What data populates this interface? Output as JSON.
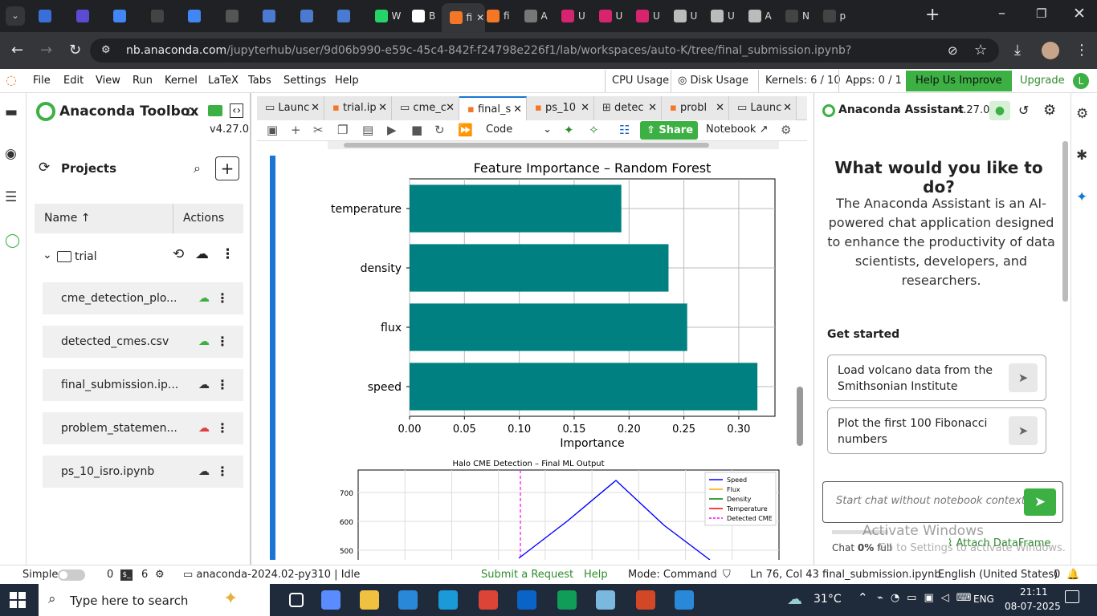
{
  "browser": {
    "tabs": [
      {
        "label": "",
        "color": "#3a6fd8"
      },
      {
        "label": "",
        "color": "#5b4bd1"
      },
      {
        "label": "",
        "color": "#4285f4"
      },
      {
        "label": "",
        "color": "#444"
      },
      {
        "label": "",
        "color": "#4285f4"
      },
      {
        "label": "",
        "color": "#555"
      },
      {
        "label": "",
        "color": "#4a7bd0"
      },
      {
        "label": "",
        "color": "#4a7bd0"
      },
      {
        "label": "",
        "color": "#4a7bd0"
      },
      {
        "label": "W",
        "color": "#25d366"
      },
      {
        "label": "B",
        "color": "#fff"
      },
      {
        "label": "fi",
        "color": "#f37726"
      },
      {
        "label": "fi",
        "color": "#f37726"
      },
      {
        "label": "A",
        "color": "#777"
      },
      {
        "label": "U",
        "color": "#d6246e"
      },
      {
        "label": "U",
        "color": "#d6246e"
      },
      {
        "label": "U",
        "color": "#d6246e"
      },
      {
        "label": "U",
        "color": "#bbb"
      },
      {
        "label": "U",
        "color": "#bbb"
      },
      {
        "label": "A",
        "color": "#bbb"
      },
      {
        "label": "N",
        "color": "#444"
      },
      {
        "label": "p",
        "color": "#444"
      }
    ],
    "url_host": "nb.anaconda.com",
    "url_path": "/jupyterhub/user/9d06b990-e59c-45c4-842f-f24798e226f1/lab/workspaces/auto-K/tree/final_submission.ipynb?"
  },
  "menu": {
    "items": [
      "File",
      "Edit",
      "View",
      "Run",
      "Kernel",
      "LaTeX",
      "Tabs",
      "Settings",
      "Help"
    ],
    "cpu": "CPU Usage",
    "disk": "Disk Usage",
    "kernels": "Kernels: 6 / 10",
    "apps": "Apps: 0 / 1",
    "help_improve": "Help Us Improve",
    "upgrade": "Upgrade",
    "avatar_letter": "L"
  },
  "toolbox": {
    "title": "Anaconda Toolbox",
    "version": "v4.27.0",
    "projects_label": "Projects",
    "col_name": "Name",
    "col_actions": "Actions",
    "folder": "trial",
    "files": [
      {
        "name": "cme_detection_plo...",
        "status": "synced"
      },
      {
        "name": "detected_cmes.csv",
        "status": "synced"
      },
      {
        "name": "final_submission.ip...",
        "status": "pending"
      },
      {
        "name": "problem_statemen...",
        "status": "error"
      },
      {
        "name": "ps_10_isro.ipynb",
        "status": "pending"
      }
    ]
  },
  "notebook": {
    "tabs": [
      "Launc",
      "trial.ip",
      "cme_c",
      "final_s",
      "ps_10",
      "detec",
      "probl",
      "Launc"
    ],
    "celltype": "Code",
    "share": "Share",
    "notebook_label": "Notebook"
  },
  "chart_data": [
    {
      "type": "bar",
      "orientation": "horizontal",
      "title": "Feature Importance – Random Forest",
      "xlabel": "Importance",
      "ylabel": "",
      "categories": [
        "temperature",
        "density",
        "flux",
        "speed"
      ],
      "values": [
        0.193,
        0.236,
        0.253,
        0.317
      ],
      "xlim": [
        0,
        0.333
      ],
      "xticks": [
        "0.00",
        "0.05",
        "0.10",
        "0.15",
        "0.20",
        "0.25",
        "0.30"
      ],
      "color": "#008080",
      "grid": true
    },
    {
      "type": "line",
      "title": "Halo CME Detection – Final ML Output",
      "yticks": [
        "700",
        "600",
        "500"
      ],
      "legend": [
        "Speed",
        "Flux",
        "Density",
        "Temperature",
        "Detected CME"
      ],
      "legend_colors": [
        "#0000ff",
        "#ffa500",
        "#008000",
        "#ff0000",
        "#ff00ff"
      ],
      "legend_position": "top-right",
      "grid": true
    }
  ],
  "assistant": {
    "title": "Anaconda Assistant",
    "version": "4.27.0",
    "heading": "What would you like to do?",
    "description": "The Anaconda Assistant is an AI-powered chat application designed to enhance the productivity of data scientists, developers, and researchers.",
    "get_started": "Get started",
    "suggestions": [
      "Load volcano data from the Smithsonian Institute",
      "Plot the first 100 Fibonacci numbers"
    ],
    "input_placeholder": "Start chat without notebook context...",
    "chat_label": "Chat",
    "chat_pct": "0%",
    "chat_full": "full",
    "attach": "Attach DataFrame",
    "watermark1": "Activate Windows",
    "watermark2": "Go to Settings to activate Windows."
  },
  "status": {
    "mode_label": "Simple",
    "count1": "0",
    "count2": "6",
    "env": "anaconda-2024.02-py310 | Idle",
    "submit": "Submit a Request",
    "help": "Help",
    "mode": "Mode: Command",
    "position": "Ln 76, Col 43",
    "file": "final_submission.ipynb",
    "lang": "English (United States)",
    "notif": "0"
  },
  "taskbar": {
    "search": "Type here to search",
    "temp": "31°C",
    "lang": "ENG",
    "time": "21:11",
    "date": "08-07-2025"
  }
}
